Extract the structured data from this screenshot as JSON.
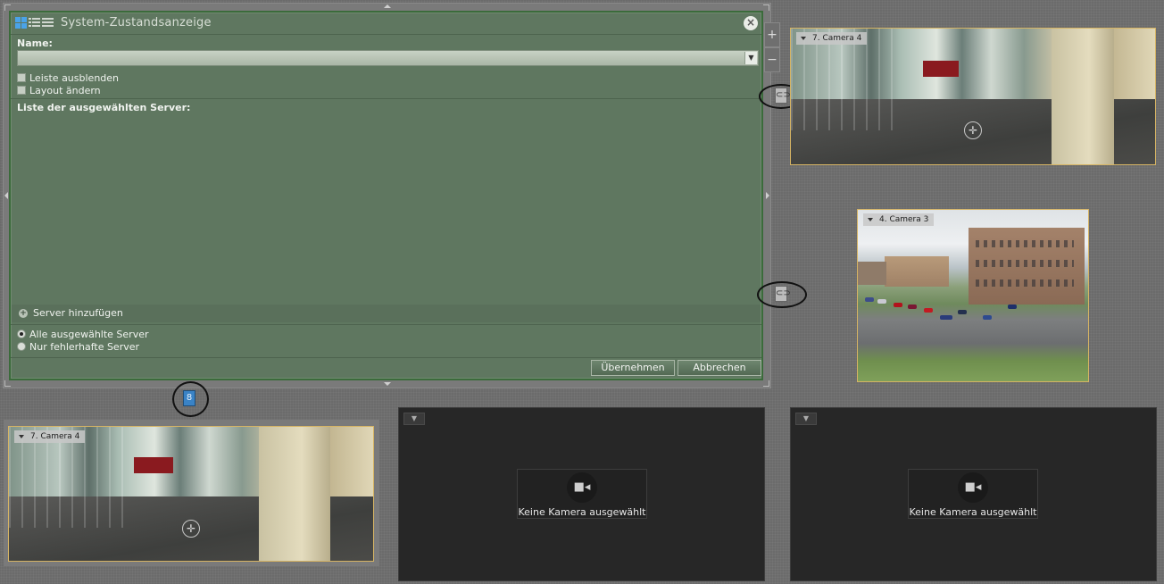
{
  "dialog": {
    "title": "System-Zustandsanzeige",
    "close_label": "×",
    "name_label": "Name:",
    "name_value": "",
    "checkbox_hide_bar": "Leiste ausblenden",
    "checkbox_change_layout": "Layout ändern",
    "server_list_label": "Liste der ausgewählten Server:",
    "add_server_label": "Server hinzufügen",
    "radio_all": "Alle ausgewählte Server",
    "radio_faulty": "Nur fehlerhafte Server",
    "apply_button": "Übernehmen",
    "cancel_button": "Abbrechen"
  },
  "zoom": {
    "plus": "+",
    "minus": "−"
  },
  "cameras": {
    "top_right": {
      "label": "7. Camera 4"
    },
    "middle_right": {
      "label": "4. Camera 3"
    },
    "bottom_left": {
      "label": "7. Camera 4"
    }
  },
  "empty_tiles": {
    "center": {
      "text": "Keine Kamera ausgewählt"
    },
    "right": {
      "text": "Keine Kamera ausgewählt"
    }
  },
  "colors": {
    "dialog_bg": "#5f7760",
    "dialog_border": "#3b6b3b",
    "camera_border": "#d6b464",
    "empty_tile_bg": "#272727"
  }
}
